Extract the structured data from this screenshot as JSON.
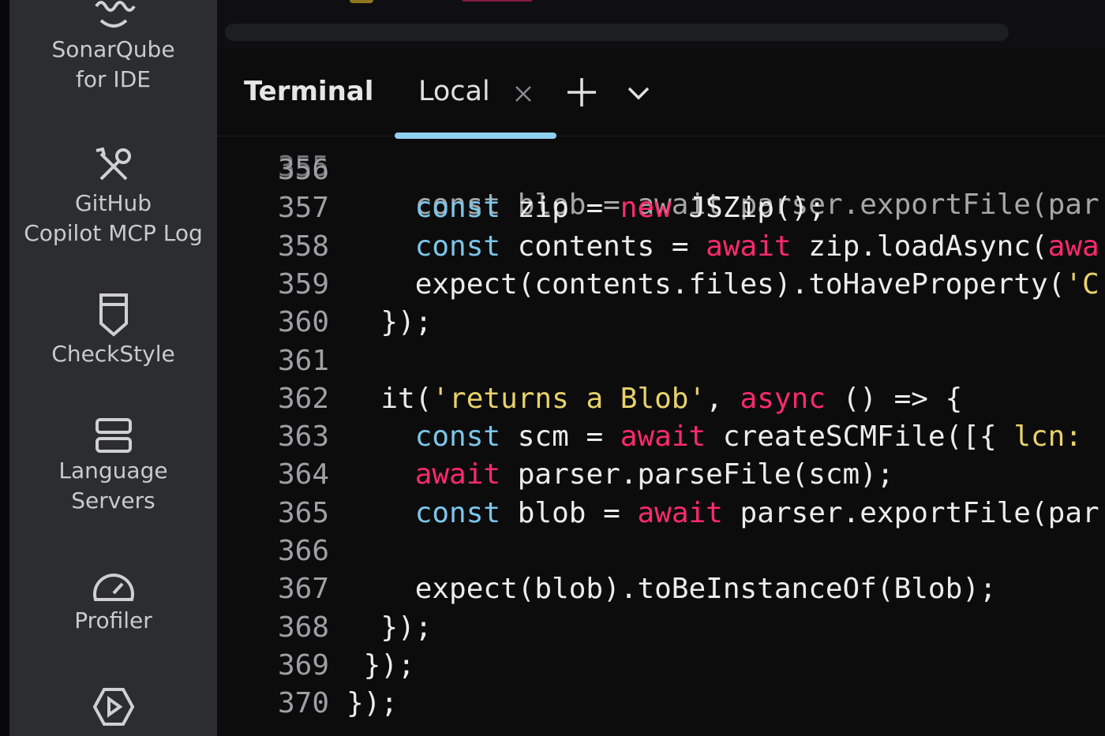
{
  "sidebar": {
    "items": [
      {
        "label_lines": [
          "SonarQube",
          "for IDE"
        ],
        "icon": "sonarqube-wave-icon"
      },
      {
        "label_lines": [
          "GitHub",
          "Copilot MCP Log"
        ],
        "icon": "wrench-screwdriver-icon"
      },
      {
        "label_lines": [
          "CheckStyle"
        ],
        "icon": "shield-badge-icon"
      },
      {
        "label_lines": [
          "Language",
          "Servers"
        ],
        "icon": "server-stack-icon"
      },
      {
        "label_lines": [
          "Profiler"
        ],
        "icon": "gauge-icon"
      },
      {
        "label_lines": [],
        "icon": "run-play-icon"
      }
    ]
  },
  "tabs": {
    "title": "Terminal",
    "active_tab": "Local",
    "close_icon": "close-icon",
    "add_icon": "plus-icon",
    "dropdown_icon": "chevron-down-icon"
  },
  "code": {
    "partial_line": {
      "num": "355",
      "text": "    const blob = await parser.exportFile(par"
    },
    "lines": [
      {
        "num": "356",
        "tokens": []
      },
      {
        "num": "357",
        "tokens": [
          [
            "    ",
            "plain"
          ],
          [
            "const",
            "kw-blue"
          ],
          [
            " zip = ",
            "plain"
          ],
          [
            "new",
            "kw-pink"
          ],
          [
            " JSZip();",
            "plain"
          ]
        ]
      },
      {
        "num": "358",
        "tokens": [
          [
            "    ",
            "plain"
          ],
          [
            "const",
            "kw-blue"
          ],
          [
            " contents = ",
            "plain"
          ],
          [
            "await",
            "kw-pink"
          ],
          [
            " zip.loadAsync(",
            "plain"
          ],
          [
            "awa",
            "kw-pink"
          ]
        ]
      },
      {
        "num": "359",
        "tokens": [
          [
            "    expect(contents.files).toHaveProperty(",
            "plain"
          ],
          [
            "'C",
            "str"
          ]
        ]
      },
      {
        "num": "360",
        "tokens": [
          [
            "  });",
            "plain"
          ]
        ]
      },
      {
        "num": "361",
        "tokens": []
      },
      {
        "num": "362",
        "tokens": [
          [
            "  it(",
            "plain"
          ],
          [
            "'returns a Blob'",
            "str"
          ],
          [
            ", ",
            "plain"
          ],
          [
            "async",
            "kw-pink"
          ],
          [
            " () => {",
            "plain"
          ]
        ]
      },
      {
        "num": "363",
        "tokens": [
          [
            "    ",
            "plain"
          ],
          [
            "const",
            "kw-blue"
          ],
          [
            " scm = ",
            "plain"
          ],
          [
            "await",
            "kw-pink"
          ],
          [
            " createSCMFile([{ ",
            "plain"
          ],
          [
            "lcn:",
            "str"
          ]
        ]
      },
      {
        "num": "364",
        "tokens": [
          [
            "    ",
            "plain"
          ],
          [
            "await",
            "kw-pink"
          ],
          [
            " parser.parseFile(scm);",
            "plain"
          ]
        ]
      },
      {
        "num": "365",
        "tokens": [
          [
            "    ",
            "plain"
          ],
          [
            "const",
            "kw-blue"
          ],
          [
            " blob = ",
            "plain"
          ],
          [
            "await",
            "kw-pink"
          ],
          [
            " parser.exportFile(par",
            "plain"
          ]
        ]
      },
      {
        "num": "366",
        "tokens": []
      },
      {
        "num": "367",
        "tokens": [
          [
            "    expect(blob).toBeInstanceOf(Blob);",
            "plain"
          ]
        ]
      },
      {
        "num": "368",
        "tokens": [
          [
            "  });",
            "plain"
          ]
        ]
      },
      {
        "num": "369",
        "tokens": [
          [
            " });",
            "plain"
          ]
        ]
      },
      {
        "num": "370",
        "tokens": [
          [
            "});",
            "plain"
          ]
        ]
      }
    ]
  },
  "colors": {
    "keyword_blue": "#7cc6ea",
    "keyword_pink": "#ff2a6d",
    "string_yellow": "#e8d26a",
    "tab_underline": "#8fd0f0",
    "sidebar_bg": "#2c2d30",
    "editor_bg": "#0c0c0d"
  }
}
